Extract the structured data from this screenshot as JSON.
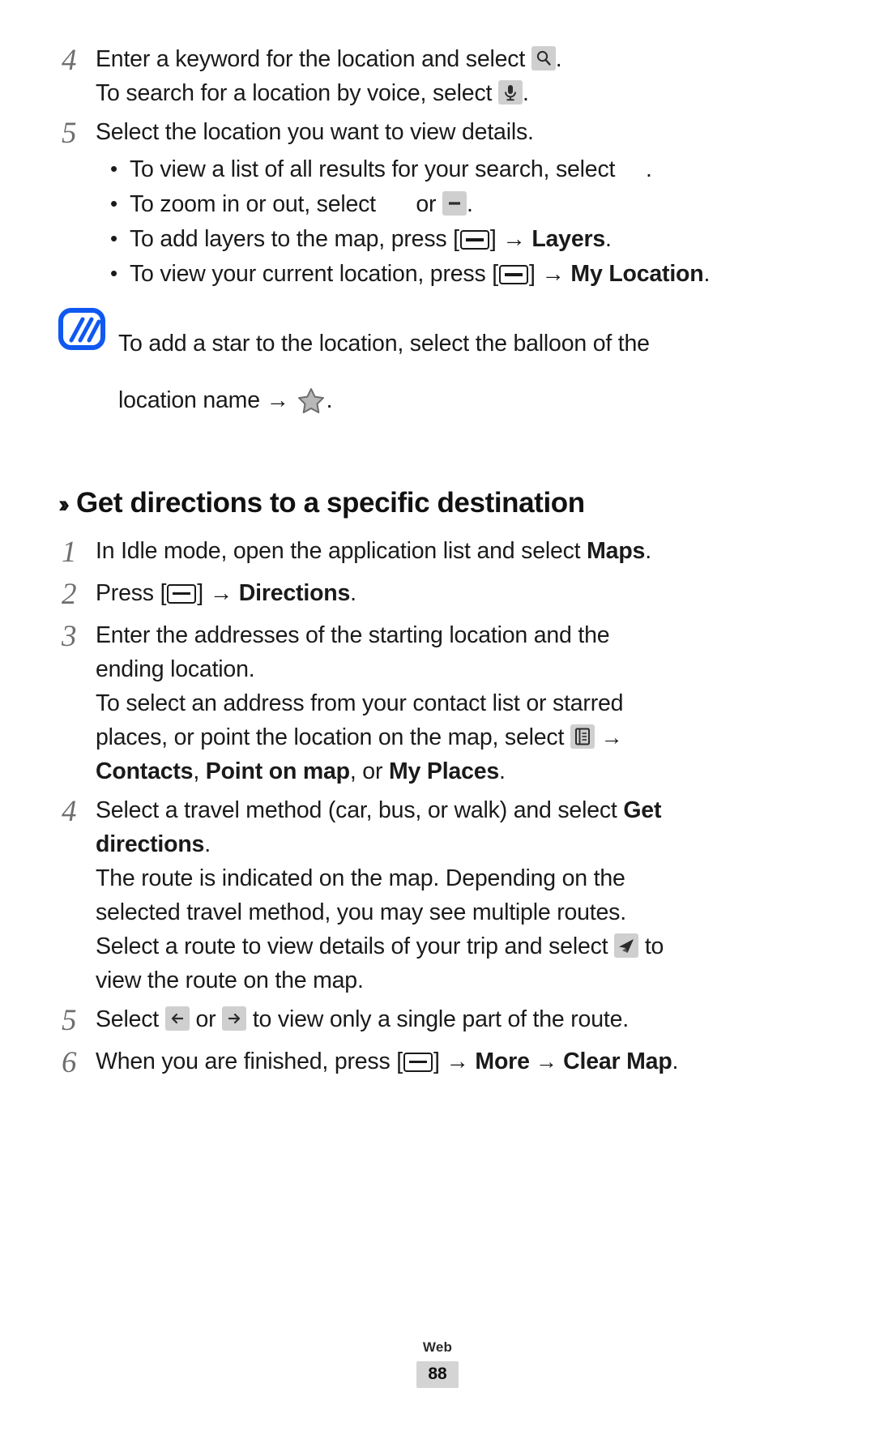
{
  "document": {
    "type": "user-manual-page",
    "section_category": "Web",
    "page_number": "88"
  },
  "steps_continued": {
    "step4": {
      "number": "4",
      "line1_before": "Enter a keyword for the location and select",
      "line1_after": ".",
      "line2_before": "To search for a location by voice, select",
      "line2_after": ".",
      "icon1": "search-icon",
      "icon2": "microphone-icon"
    },
    "step5": {
      "number": "5",
      "text": "Select the location you want to view details.",
      "bullets": [
        {
          "before": "To view a list of all results for your search, select",
          "icon": "list-results-icon",
          "after": "."
        },
        {
          "before": "To zoom in or out, select",
          "icon": "zoom-in-icon",
          "middle": "or",
          "icon2": "zoom-out-icon",
          "after": "."
        },
        {
          "before": "To add layers to the map, press [",
          "icon": "menu-key-icon",
          "mid": "] → ",
          "bold": "Layers",
          "after": "."
        },
        {
          "before": "To view your current location, press [",
          "icon": "menu-key-icon",
          "mid": "] → ",
          "bold": "My Location",
          "after": "."
        }
      ]
    }
  },
  "note": {
    "icon": "note-memo-icon",
    "icon_color": "#1058f0",
    "line1": "To add a star to the location, select the balloon of the",
    "line2_before": "location name →",
    "star_icon": "star-icon",
    "line2_after": "."
  },
  "section": {
    "chevron": "››",
    "title": "Get directions to a specific destination",
    "steps": [
      {
        "number": "1",
        "before": "In Idle mode, open the application list and select",
        "bold": "Maps",
        "after": "."
      },
      {
        "number": "2",
        "before": "Press [",
        "icon": "menu-key-icon",
        "mid": "] → ",
        "bold": "Directions",
        "after": "."
      },
      {
        "number": "3",
        "line1": "Enter the addresses of the starting location and the",
        "line2": "ending location.",
        "para1_line1": "To select an address from your contact list or starred",
        "para1_line2_before": "places, or point the location on the map, select",
        "para1_icon": "contacts-book-icon",
        "para1_line2_after": "→",
        "para2_bold1": "Contacts",
        "para2_sep1": ", ",
        "para2_bold2": "Point on map",
        "para2_sep2": ", or ",
        "para2_bold3": "My Places",
        "para2_end": "."
      },
      {
        "number": "4",
        "line1_before": "Select a travel method (car, bus, or walk) and select",
        "line1_bold": "Get",
        "line2_bold": "directions",
        "line2_after": ".",
        "para_line1": "The route is indicated on the map. Depending on the",
        "para_line2": "selected travel method, you may see multiple routes.",
        "para_line3_before": "Select a route to view details of your trip and select",
        "para_icon": "navigate-route-icon",
        "para_line3_after": "to",
        "para_line4": "view the route on the map."
      },
      {
        "number": "5",
        "before": "Select",
        "icon1": "arrow-left-icon",
        "middle": "or",
        "icon2": "arrow-right-icon",
        "after": "to view only a single part of the route."
      },
      {
        "number": "6",
        "before": "When you are finished, press [",
        "icon": "menu-key-icon",
        "mid": "] → ",
        "bold1": "More",
        "arrow": " → ",
        "bold2": "Clear Map",
        "after": "."
      }
    ]
  }
}
